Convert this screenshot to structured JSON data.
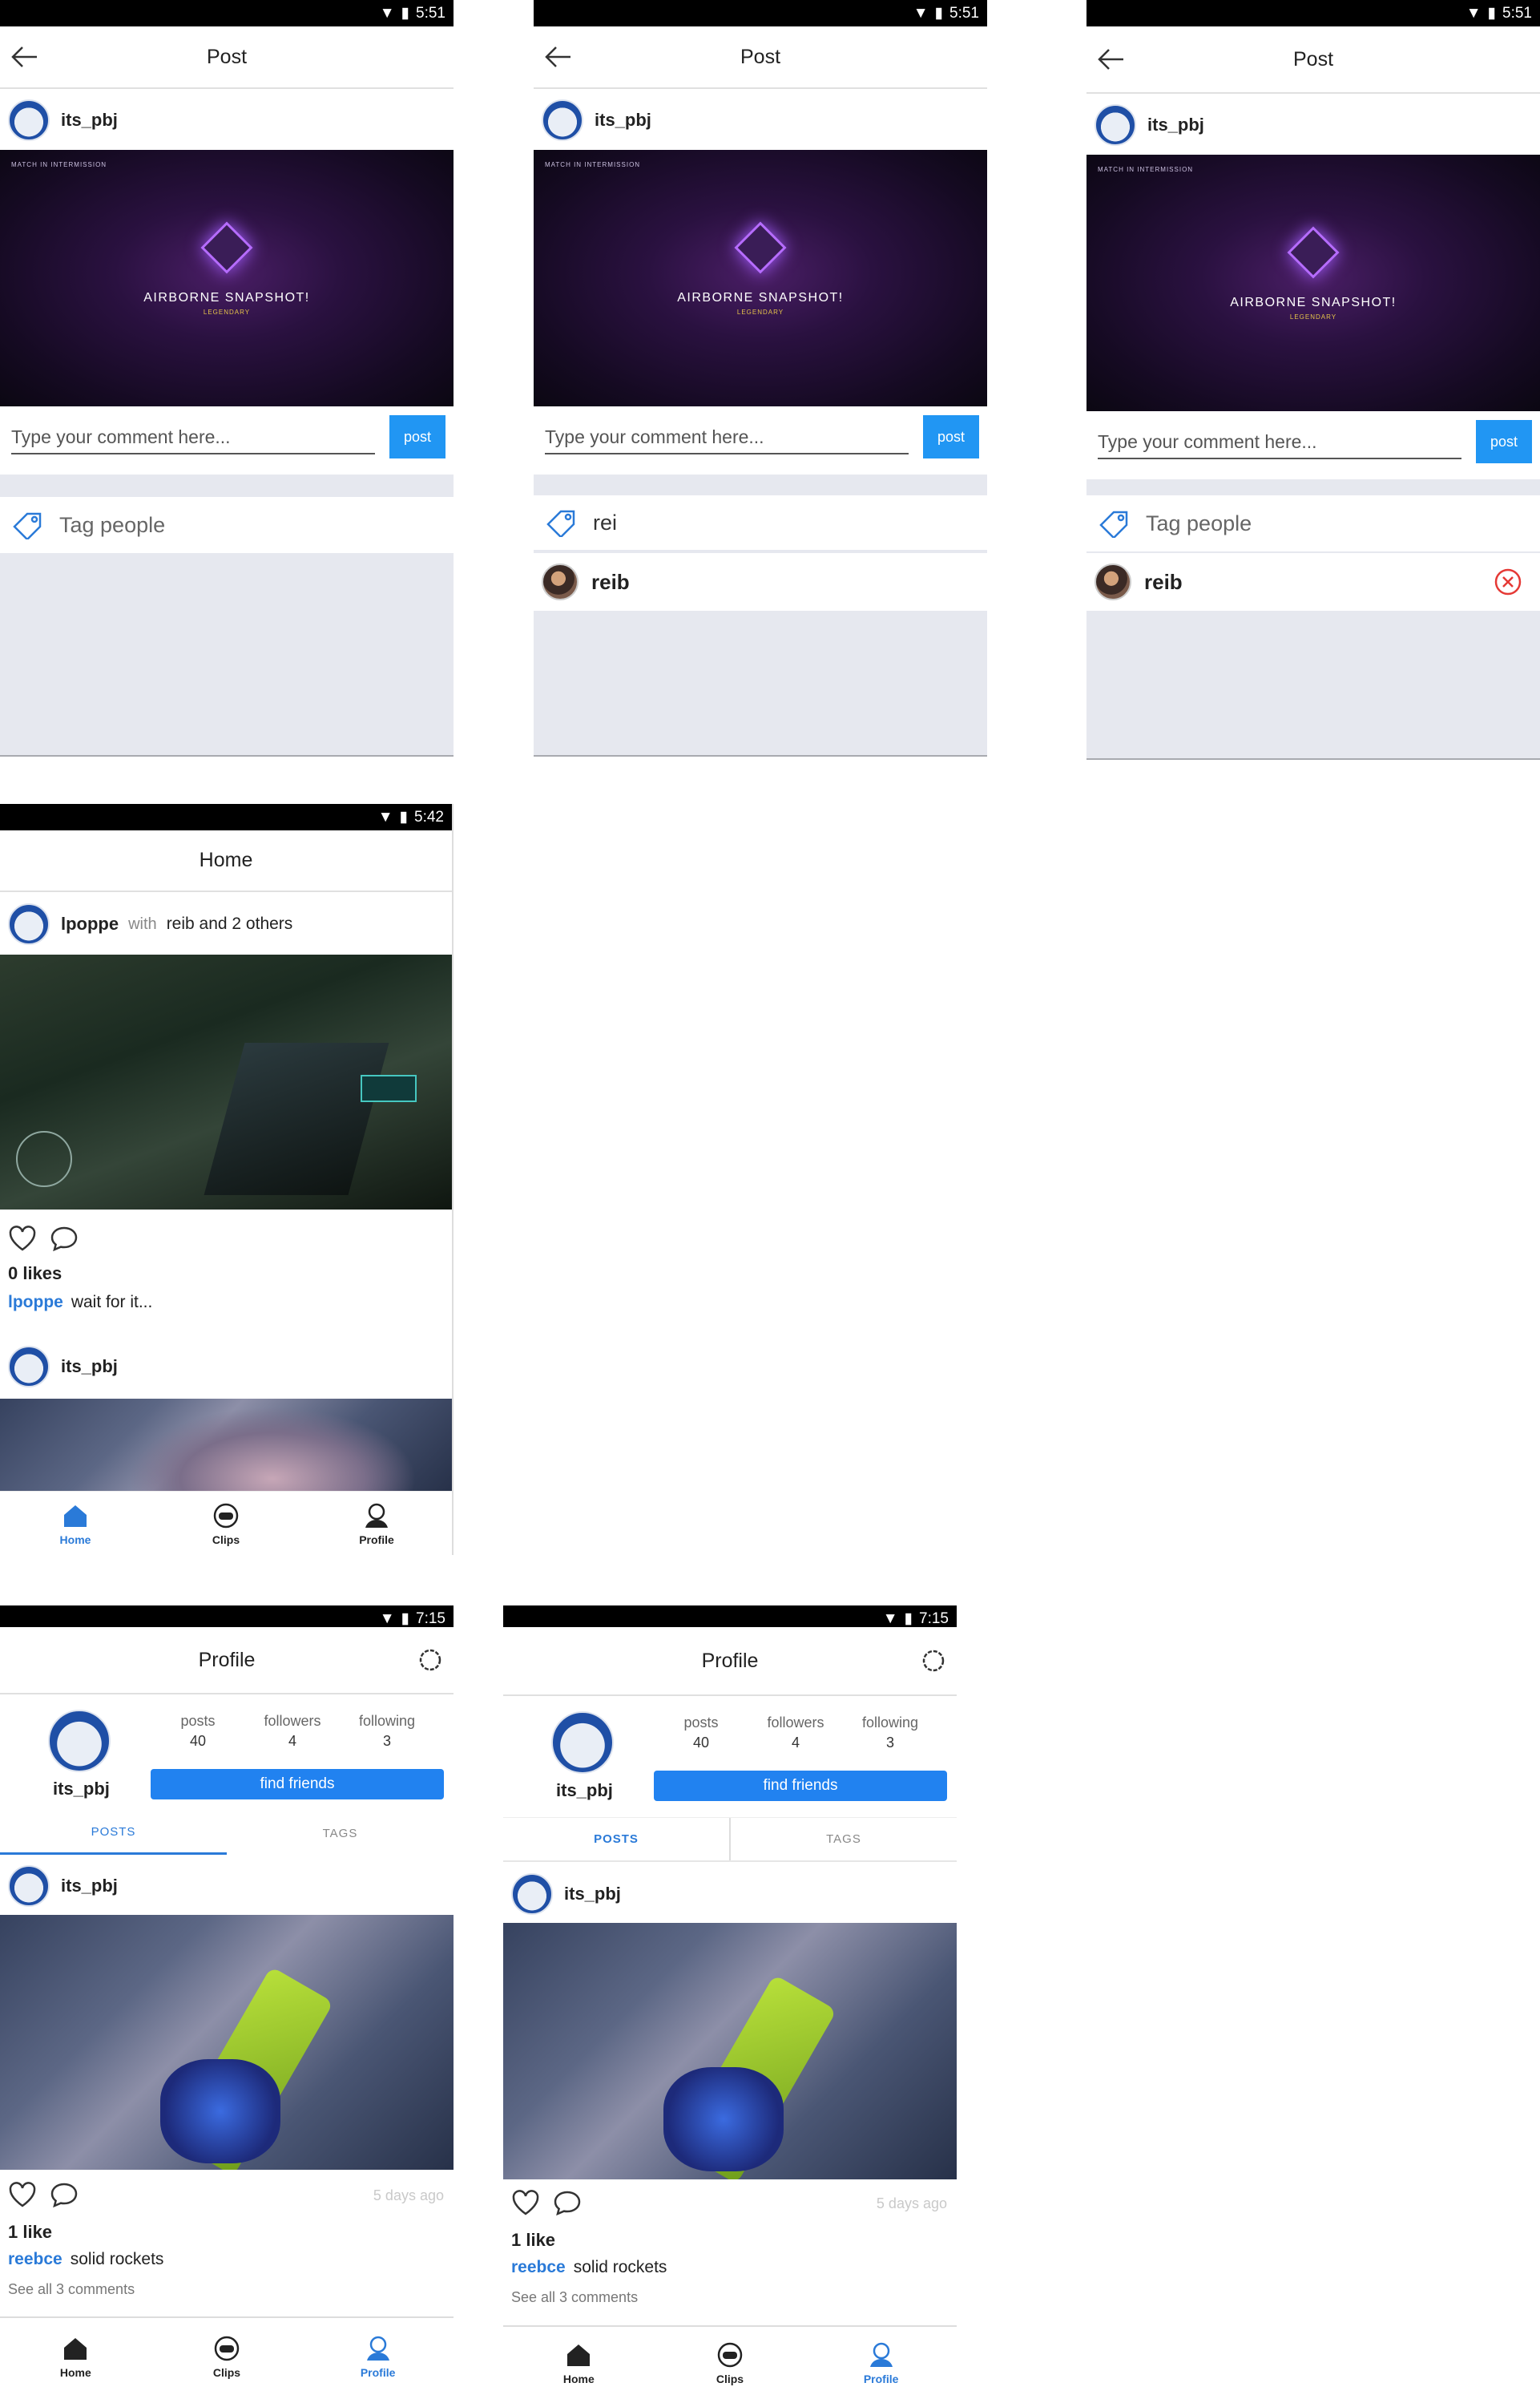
{
  "status_bar": {
    "time_post": "5:51",
    "time_home": "5:42",
    "time_profile": "7:15"
  },
  "post_screen": {
    "title": "Post",
    "username": "its_pbj",
    "media": {
      "hud_text": "MATCH IN INTERMISSION",
      "title": "AIRBORNE SNAPSHOT!",
      "subtitle": "LEGENDARY"
    },
    "comment_placeholder": "Type your comment here...",
    "post_button": "post",
    "tag_placeholder": "Tag people",
    "tag_typed": "rei",
    "suggested_user": "reib"
  },
  "home_screen": {
    "title": "Home",
    "post1": {
      "username": "lpoppe",
      "with_label": "with",
      "with_text": "reib and 2 others",
      "likes": "0 likes",
      "caption_user": "lpoppe",
      "caption_text": "wait for it..."
    },
    "post2": {
      "username": "its_pbj"
    }
  },
  "profile_screen": {
    "title": "Profile",
    "username": "its_pbj",
    "stats": [
      {
        "label": "posts",
        "value": "40"
      },
      {
        "label": "followers",
        "value": "4"
      },
      {
        "label": "following",
        "value": "3"
      }
    ],
    "find_friends": "find friends",
    "tabs": [
      "POSTS",
      "TAGS"
    ],
    "post": {
      "username": "its_pbj",
      "time_ago": "5 days ago",
      "likes": "1 like",
      "caption_user": "reebce",
      "caption_text": "solid rockets",
      "see_all": "See all 3 comments"
    }
  },
  "nav": {
    "home": "Home",
    "clips": "Clips",
    "profile": "Profile"
  },
  "colors": {
    "accent": "#2196f3",
    "link": "#2a7ad8",
    "panel_grey": "#e6e8ef",
    "remove_red": "#e53935"
  }
}
